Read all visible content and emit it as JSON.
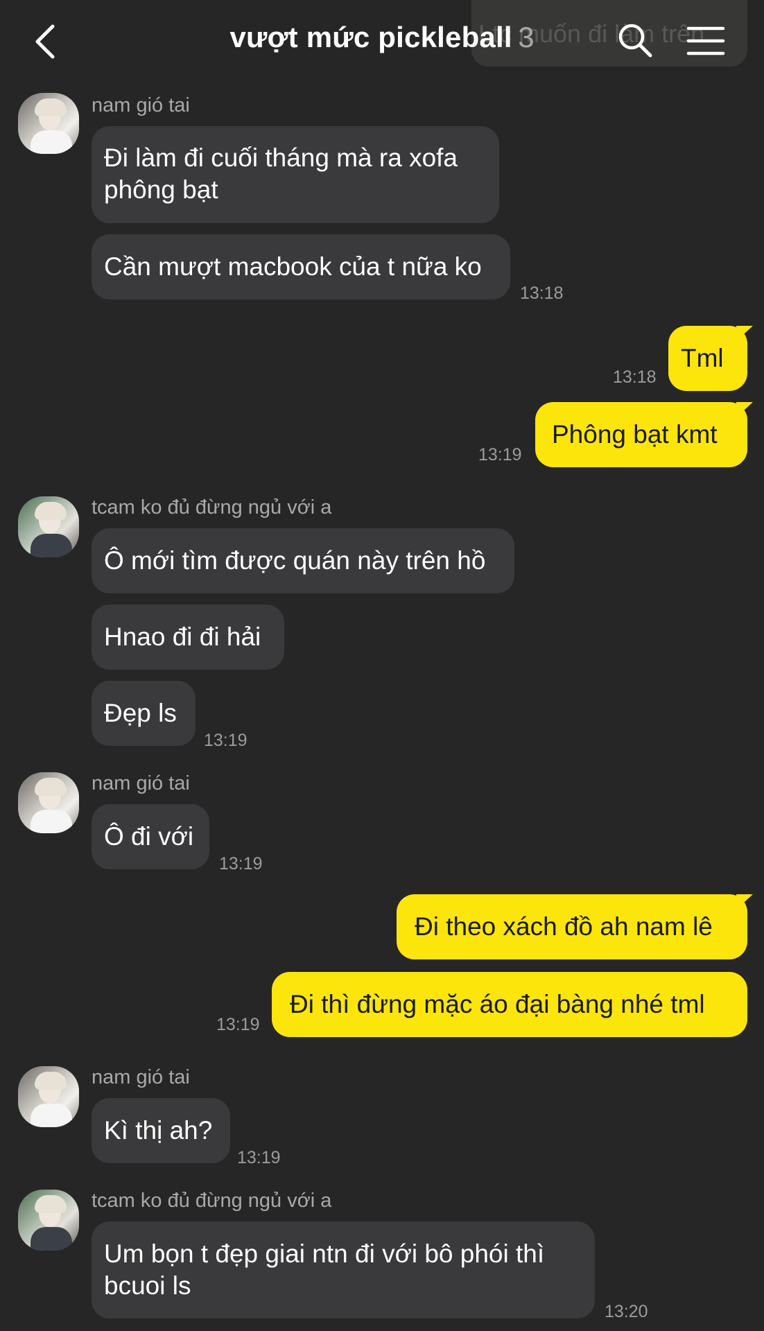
{
  "header": {
    "title": "vượt mức pickleball",
    "member_count": "3",
    "ghost_text": "Ltc muốn đi làm trên"
  },
  "icons": {
    "back": "chevron-left-icon",
    "search": "search-icon",
    "menu": "hamburger-menu-icon"
  },
  "colors": {
    "background": "#262626",
    "incoming_bubble": "#3a3a3c",
    "outgoing_bubble": "#fce50a"
  },
  "messages": {
    "g1": {
      "sender": "nam gió tai",
      "m1": "Đi làm đi cuối tháng mà ra xofa",
      "m1b": "phông bạt",
      "m2": "Cần mượt macbook của t nữa ko",
      "time": "13:18"
    },
    "o1": {
      "m1": "Tml",
      "t1": "13:18",
      "m2": "Phông bạt kmt",
      "t2": "13:19"
    },
    "g2": {
      "sender": "tcam ko đủ đừng ngủ với a",
      "m1": "Ô mới tìm được quán này trên hồ",
      "m2": "Hnao đi đi hải",
      "m3": "Đẹp ls",
      "time": "13:19"
    },
    "g3": {
      "sender": "nam gió tai",
      "m1": "Ô đi với",
      "time": "13:19"
    },
    "o2": {
      "m1": "Đi theo xách đồ ah nam lê",
      "m2": "Đi thì đừng mặc áo đại bàng nhé tml",
      "time": "13:19"
    },
    "g4": {
      "sender": "nam gió tai",
      "m1": "Kì thị ah?",
      "time": "13:19"
    },
    "g5": {
      "sender": "tcam ko đủ đừng ngủ với a",
      "m1": "Um bọn t đẹp giai ntn đi với bô phói thì",
      "m1b": "bcuoi ls",
      "time": "13:20"
    }
  }
}
